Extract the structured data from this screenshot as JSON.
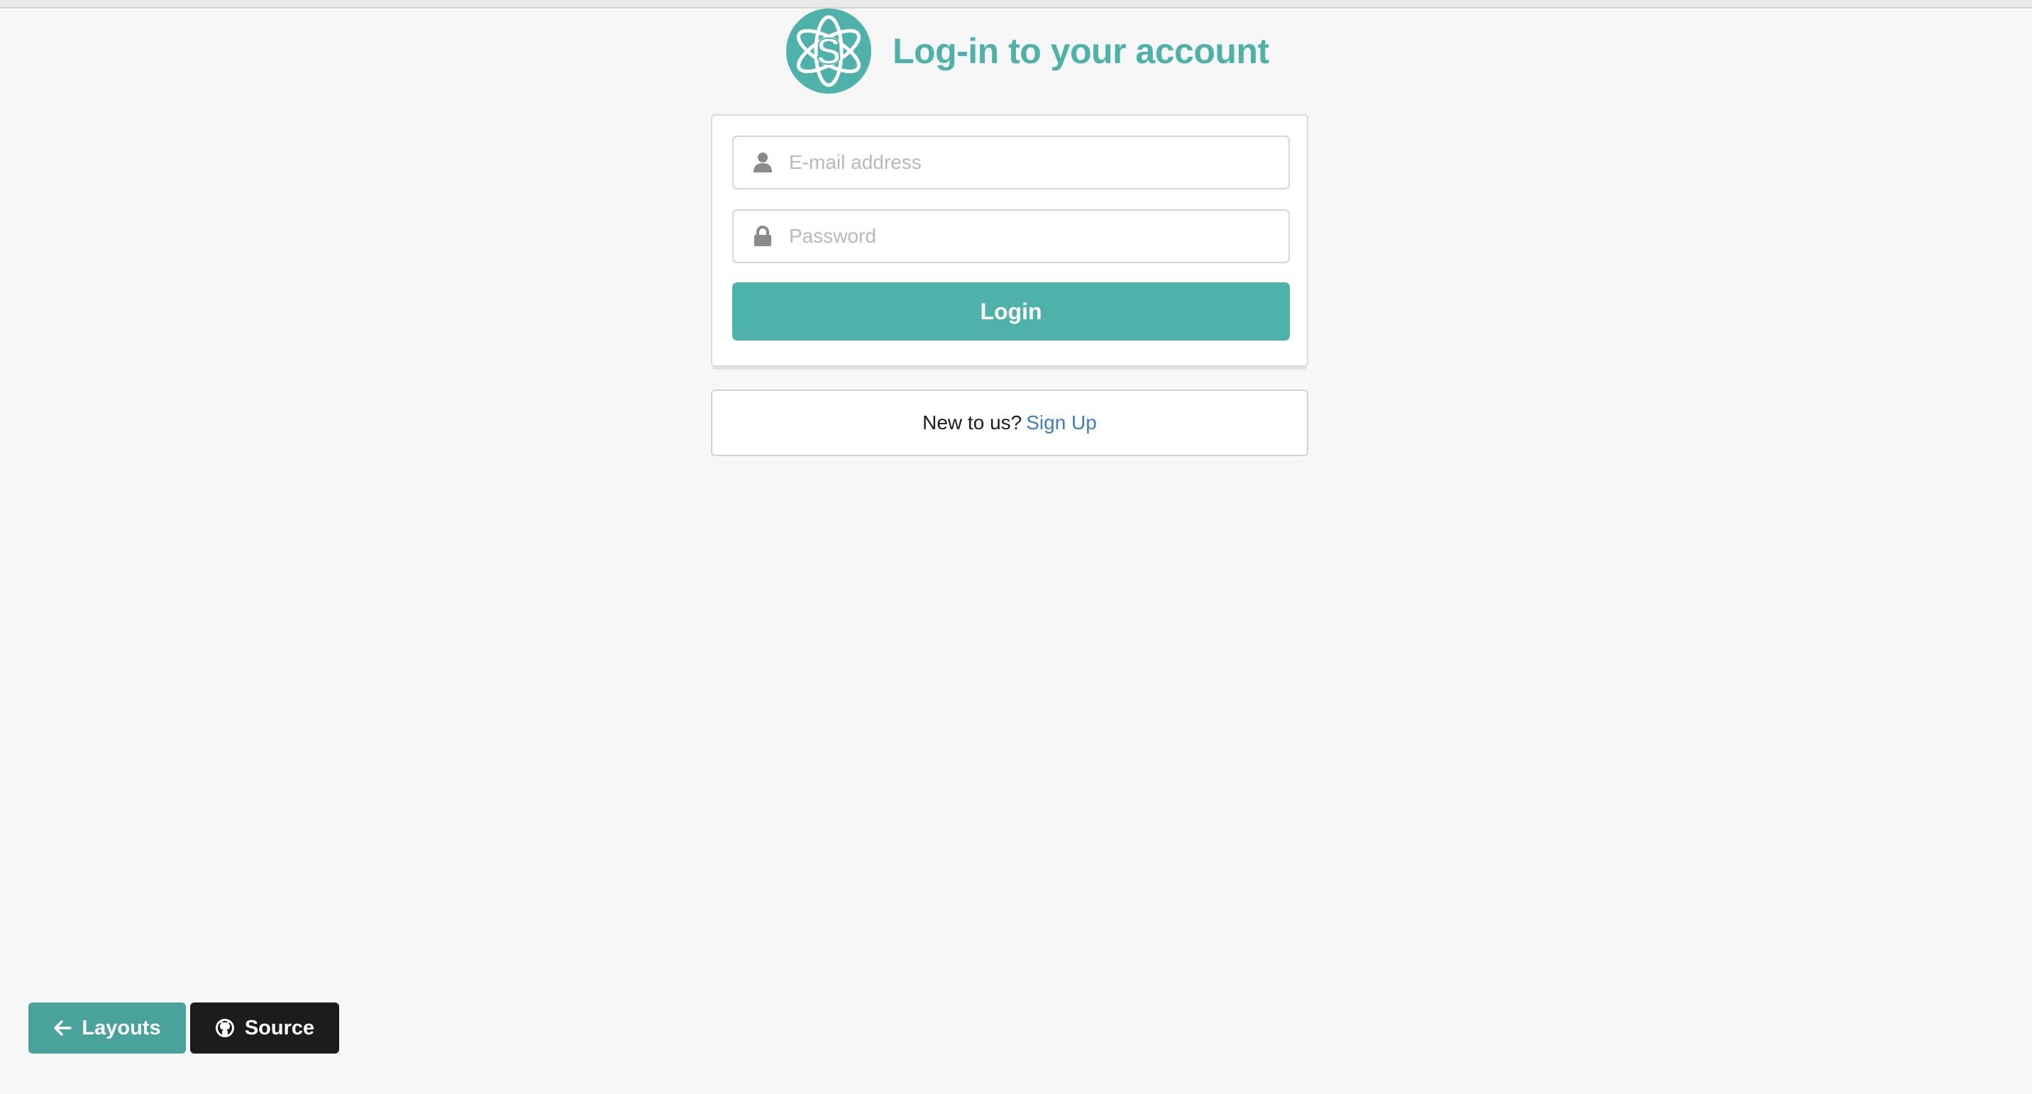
{
  "header": {
    "title": "Log-in to your account",
    "logo_icon": "semantic-atom-logo-icon",
    "logo_letter": "S"
  },
  "colors": {
    "accent": "#4eb2aa",
    "link": "#3f7cc0",
    "dark_button": "#1b1c1d",
    "layouts_button": "#4aa39b"
  },
  "form": {
    "email": {
      "placeholder": "E-mail address",
      "value": "",
      "icon": "user-icon"
    },
    "password": {
      "placeholder": "Password",
      "value": "",
      "icon": "lock-icon"
    },
    "login_label": "Login"
  },
  "message": {
    "text": "New to us?",
    "link_label": "Sign Up"
  },
  "footer_buttons": {
    "layouts": {
      "label": "Layouts",
      "icon": "arrow-left-icon"
    },
    "source": {
      "label": "Source",
      "icon": "github-icon"
    }
  }
}
